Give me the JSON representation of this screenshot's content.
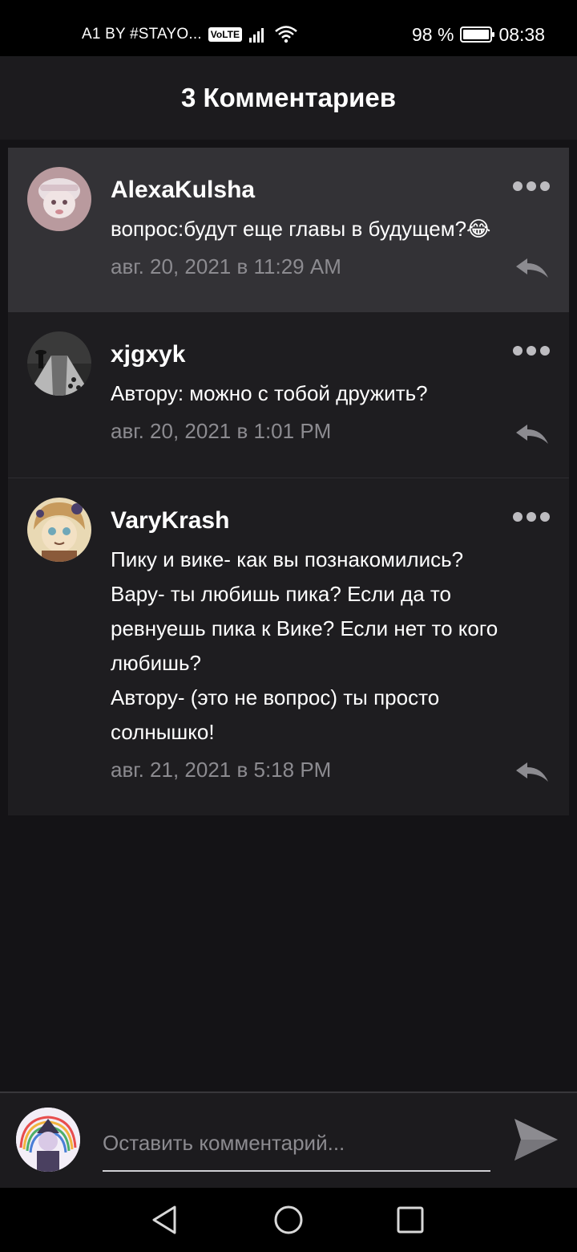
{
  "status_bar": {
    "carrier": "A1 BY #STAYO...",
    "volte": "VoLTE",
    "battery_percent": "98 %",
    "battery_level": 0.98,
    "time": "08:38",
    "icons": [
      "signal-icon",
      "wifi-icon",
      "battery-icon"
    ]
  },
  "header": {
    "title": "3 Комментариев"
  },
  "comments": [
    {
      "username": "AlexaKulsha",
      "text": "вопрос:будут еще главы в будущем?😂",
      "date": "авг. 20, 2021 в 11:29 AM",
      "highlighted": true
    },
    {
      "username": "xjgxyk",
      "text": "Автору: можно с тобой дружить?",
      "date": "авг. 20, 2021 в 1:01 PM",
      "highlighted": false
    },
    {
      "username": "VaryKrash",
      "text": "Пику и вике- как вы познакомились?\nВару- ты любишь пика? Если да то ревнуешь пика к Вике? Если нет то кого любишь?\nАвтору- (это не вопрос) ты просто солнышко!",
      "date": "авг. 21, 2021 в 5:18 PM",
      "highlighted": false
    }
  ],
  "input": {
    "placeholder": "Оставить комментарий..."
  },
  "colors": {
    "background": "#141316",
    "card": "#1e1d20",
    "card_highlight": "#333236",
    "muted_text": "#8c8b90"
  }
}
